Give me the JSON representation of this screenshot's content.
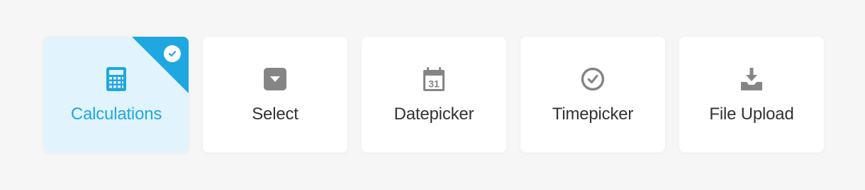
{
  "colors": {
    "accent": "#1ea7e1",
    "selected_bg": "#e1f3fc",
    "icon_gray": "#858585",
    "text_dark": "#333333"
  },
  "options": [
    {
      "label": "Calculations",
      "icon": "calculator-icon",
      "selected": true
    },
    {
      "label": "Select",
      "icon": "dropdown-icon",
      "selected": false
    },
    {
      "label": "Datepicker",
      "icon": "calendar-icon",
      "selected": false
    },
    {
      "label": "Timepicker",
      "icon": "clock-icon",
      "selected": false
    },
    {
      "label": "File Upload",
      "icon": "upload-icon",
      "selected": false
    }
  ],
  "calendar_icon_text": "31"
}
